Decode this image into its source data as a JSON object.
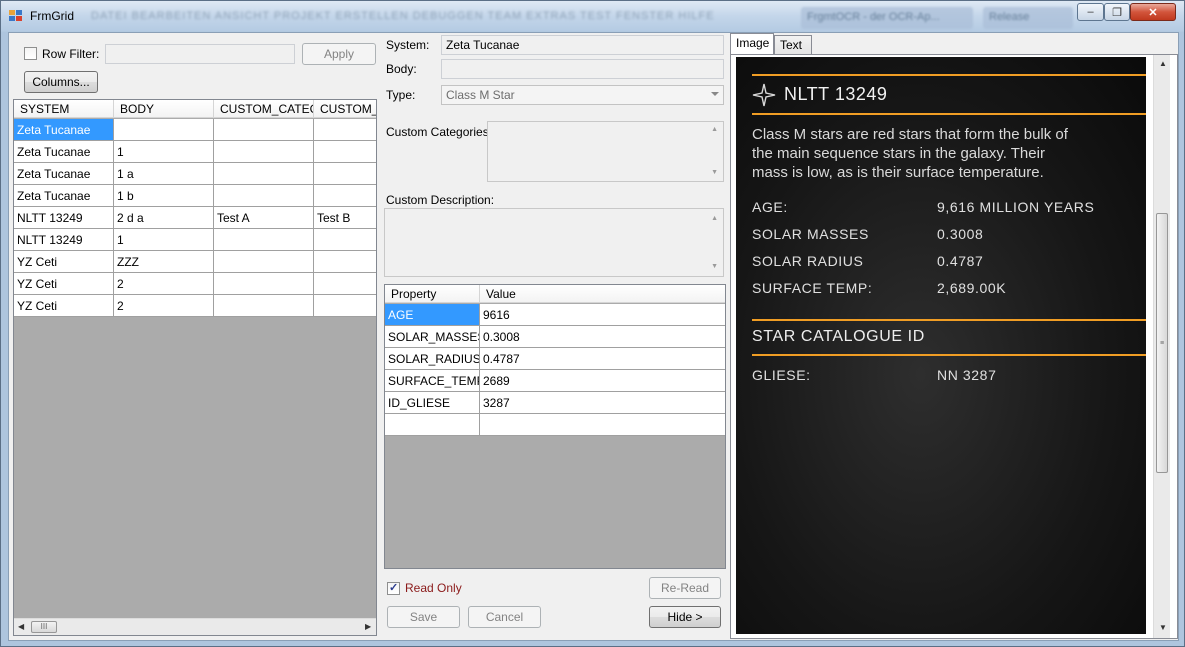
{
  "window": {
    "title": "FrmGrid",
    "blurred_menu": "DATEI  BEARBEITEN  ANSICHT  PROJEKT  ERSTELLEN  DEBUGGEN  TEAM  EXTRAS  TEST  FENSTER  HILFE",
    "blurred_tab_1": "FrgmtOCR - der OCR-Ap...",
    "blurred_tab_2": "Release",
    "minimize": "‒",
    "maximize": "❐",
    "close": "✕"
  },
  "left": {
    "row_filter_label": "Row Filter:",
    "row_filter_value": "",
    "apply_label": "Apply",
    "columns_label": "Columns...",
    "columns": [
      "SYSTEM",
      "BODY",
      "CUSTOM_CATEG(",
      "CUSTOM_I"
    ],
    "rows": [
      [
        "Zeta Tucanae",
        "",
        "",
        ""
      ],
      [
        "Zeta Tucanae",
        "1",
        "",
        ""
      ],
      [
        "Zeta Tucanae",
        "1 a",
        "",
        ""
      ],
      [
        "Zeta Tucanae",
        "1 b",
        "",
        ""
      ],
      [
        "NLTT 13249",
        "2 d a",
        "Test A",
        "Test B"
      ],
      [
        "NLTT 13249",
        "1",
        "",
        ""
      ],
      [
        "YZ Ceti",
        "ZZZ",
        "",
        ""
      ],
      [
        "YZ Ceti",
        "2",
        "",
        ""
      ],
      [
        "YZ Ceti",
        "2",
        "",
        ""
      ]
    ],
    "hscroll_grip": "III"
  },
  "middle": {
    "system_label": "System:",
    "system_value": "Zeta Tucanae",
    "body_label": "Body:",
    "body_value": "",
    "type_label": "Type:",
    "type_value": "Class M Star",
    "custom_categories_label": "Custom Categories:",
    "custom_description_label": "Custom Description:",
    "prop_columns": [
      "Property",
      "Value"
    ],
    "properties": [
      [
        "AGE",
        "9616"
      ],
      [
        "SOLAR_MASSES",
        "0.3008"
      ],
      [
        "SOLAR_RADIUS",
        "0.4787"
      ],
      [
        "SURFACE_TEMP",
        "2689"
      ],
      [
        "ID_GLIESE",
        "3287"
      ],
      [
        "",
        ""
      ]
    ],
    "read_only_label": "Read Only",
    "reread_label": "Re-Read",
    "save_label": "Save",
    "cancel_label": "Cancel",
    "hide_label": "Hide >"
  },
  "right": {
    "tabs": [
      "Image",
      "Text"
    ],
    "star_name": "NLTT 13249",
    "description_lines": [
      "Class M stars are red stars that form the bulk of",
      "the main sequence stars in the galaxy. Their",
      "mass is low, as is their surface temperature."
    ],
    "stats": [
      [
        "AGE:",
        "9,616 MILLION YEARS"
      ],
      [
        "SOLAR MASSES",
        "0.3008"
      ],
      [
        "SOLAR RADIUS",
        "0.4787"
      ],
      [
        "SURFACE TEMP:",
        "2,689.00K"
      ]
    ],
    "catalogue_heading": "STAR CATALOGUE ID",
    "catalogue": [
      [
        "GLIESE:",
        "NN 3287"
      ]
    ],
    "scroll_grip": "≡"
  },
  "colors": {
    "selection": "#3399ff",
    "accent_orange": "#f09d24",
    "read_only_text": "#8b1a1a"
  }
}
